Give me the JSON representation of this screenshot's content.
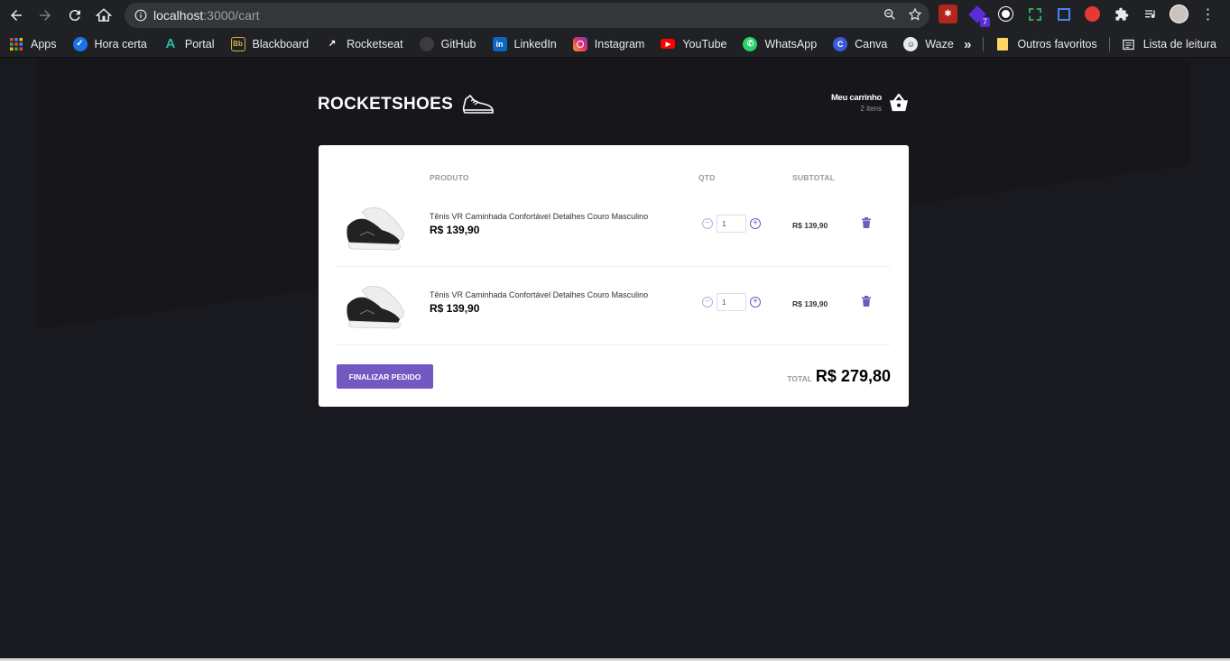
{
  "browser": {
    "url_host": "localhost",
    "url_rest": ":3000/cart",
    "extension_badge": "7",
    "bookmarks": [
      {
        "label": "Apps",
        "icon": "apps-grid-icon",
        "color": "#e8eaed"
      },
      {
        "label": "Hora certa",
        "icon": "clock-icon",
        "color": "#1a73e8"
      },
      {
        "label": "Portal",
        "icon": "portal-a-icon",
        "color": "#20c0a0"
      },
      {
        "label": "Blackboard",
        "icon": "blackboard-icon",
        "color": "#d7b23a"
      },
      {
        "label": "Rocketseat",
        "icon": "rocketseat-icon",
        "color": "#ffffff"
      },
      {
        "label": "GitHub",
        "icon": "github-icon",
        "color": "#e8eaed"
      },
      {
        "label": "LinkedIn",
        "icon": "linkedin-icon",
        "color": "#0a66c2"
      },
      {
        "label": "Instagram",
        "icon": "instagram-icon",
        "color": "#e1306c"
      },
      {
        "label": "YouTube",
        "icon": "youtube-icon",
        "color": "#ff0000"
      },
      {
        "label": "WhatsApp",
        "icon": "whatsapp-icon",
        "color": "#25d366"
      },
      {
        "label": "Canva",
        "icon": "canva-icon",
        "color": "#3b5bdb"
      },
      {
        "label": "Waze",
        "icon": "waze-icon",
        "color": "#e8eaed"
      }
    ],
    "more_bookmarks": "»",
    "other_favorites": "Outros favoritos",
    "reading_list": "Lista de leitura"
  },
  "header": {
    "logo": "ROCKETSHOES",
    "cart_title": "Meu carrinho",
    "cart_count": "2 itens"
  },
  "cart": {
    "columns": {
      "product": "PRODUTO",
      "qty": "QTD",
      "subtotal": "SUBTOTAL"
    },
    "items": [
      {
        "title": "Tênis VR Caminhada Confortável Detalhes Couro Masculino",
        "price": "R$ 139,90",
        "qty": "1",
        "subtotal": "R$ 139,90"
      },
      {
        "title": "Tênis VR Caminhada Confortável Detalhes Couro Masculino",
        "price": "R$ 139,90",
        "qty": "1",
        "subtotal": "R$ 139,90"
      }
    ],
    "checkout_label": "FINALIZAR PEDIDO",
    "total_label": "TOTAL",
    "total_value": "R$ 279,80"
  },
  "colors": {
    "accent": "#7159c1",
    "background": "#191920"
  }
}
